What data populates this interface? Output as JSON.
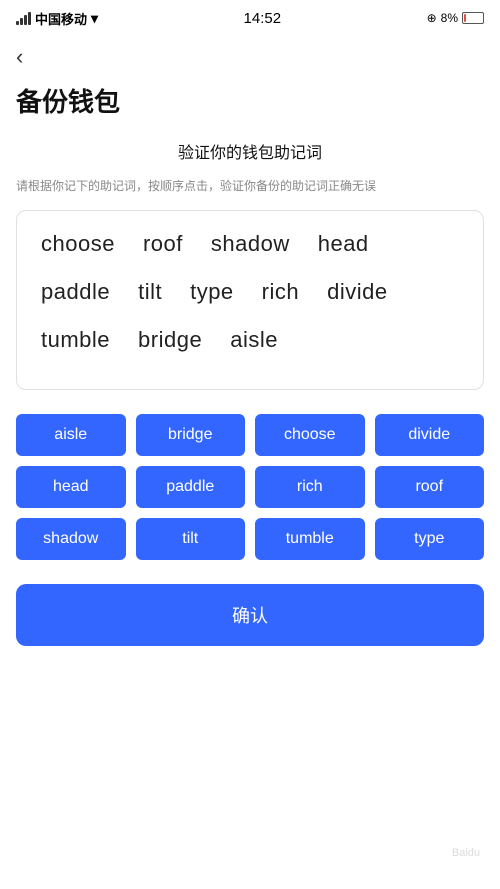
{
  "statusBar": {
    "carrier": "中国移动",
    "time": "14:52",
    "battery": "8%"
  },
  "backLabel": "‹",
  "pageTitle": "备份钱包",
  "subtitleMain": "验证你的钱包助记词",
  "subtitleDesc": "请根据你记下的助记词，按顺序点击，验证你备份的助记词正确无误",
  "wordBoxRows": [
    [
      "choose",
      "roof",
      "shadow",
      "head"
    ],
    [
      "paddle",
      "tilt",
      "type",
      "rich",
      "divide"
    ],
    [
      "tumble",
      "bridge",
      "aisle"
    ]
  ],
  "wordButtons": [
    "aisle",
    "bridge",
    "choose",
    "divide",
    "head",
    "paddle",
    "rich",
    "roof",
    "shadow",
    "tilt",
    "tumble",
    "type"
  ],
  "confirmLabel": "确认",
  "watermark": "Baidu"
}
